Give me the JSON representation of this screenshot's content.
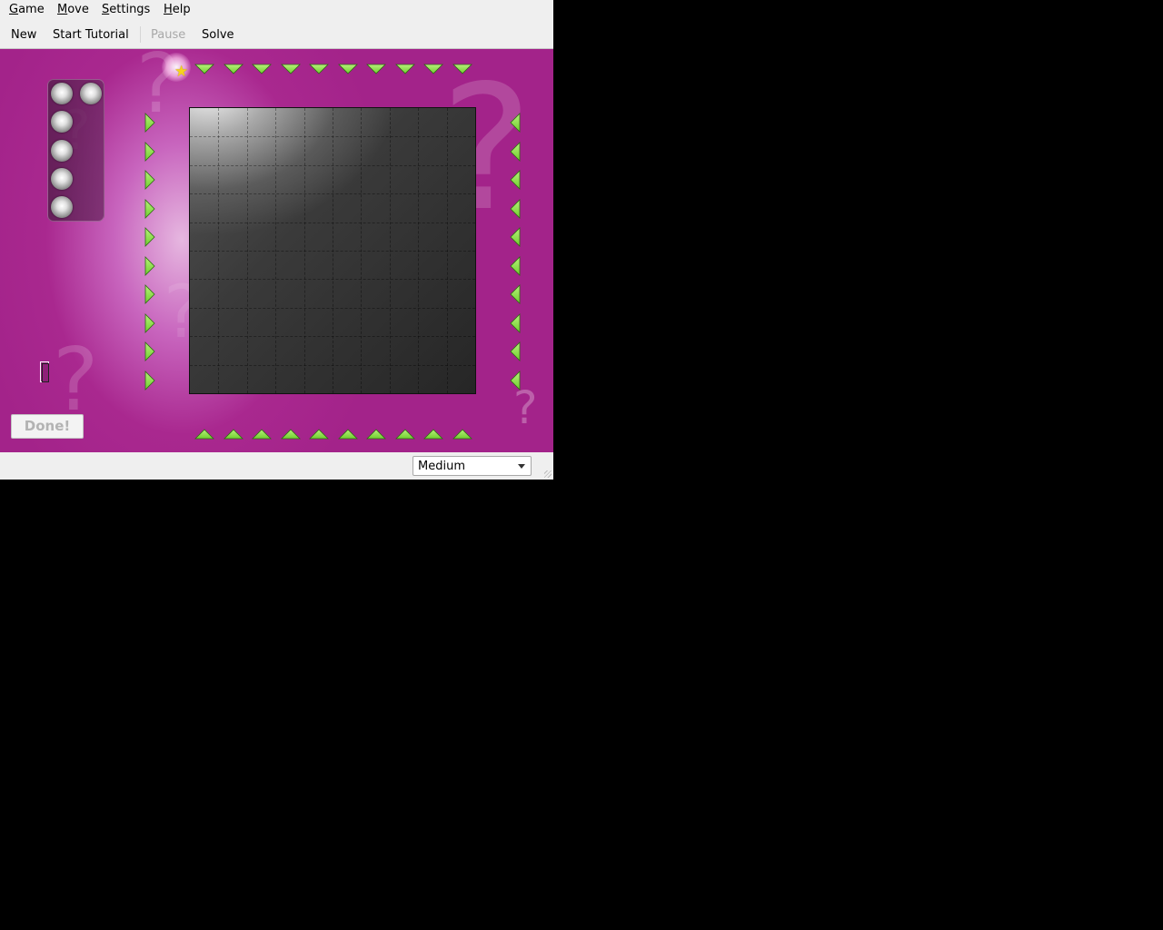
{
  "menubar": {
    "items": [
      {
        "mnemonic": "G",
        "rest": "ame"
      },
      {
        "mnemonic": "M",
        "rest": "ove"
      },
      {
        "mnemonic": "S",
        "rest": "ettings"
      },
      {
        "mnemonic": "H",
        "rest": "elp"
      }
    ]
  },
  "toolbar": {
    "new_label": "New",
    "tutorial_label": "Start Tutorial",
    "pause_label": "Pause",
    "solve_label": "Solve"
  },
  "game": {
    "atoms_remaining": 5,
    "board_size": 10,
    "arrow_color": "#6fcf2e",
    "background_color": "#a3238a"
  },
  "done_button": {
    "label": "Done!"
  },
  "statusbar": {
    "difficulty": "Medium"
  },
  "colors": {
    "menubar_bg": "#efefef",
    "board_dark": "#262626",
    "accent_green": "#6fcf2e",
    "star_yellow": "#f6d21e"
  }
}
